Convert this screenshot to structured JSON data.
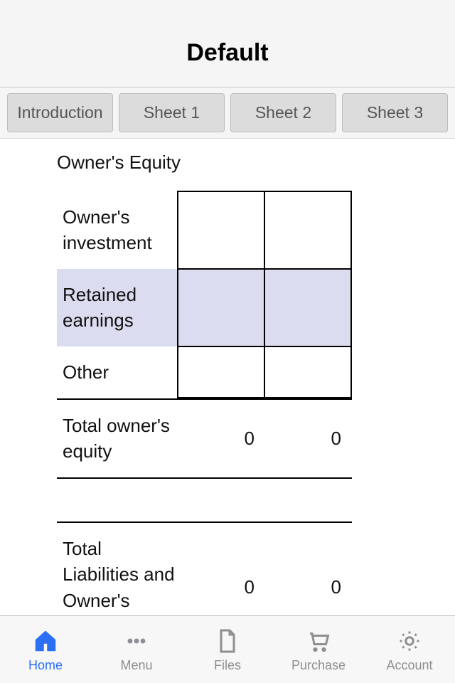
{
  "header": {
    "title": "Default"
  },
  "tabs": [
    "Introduction",
    "Sheet 1",
    "Sheet 2",
    "Sheet 3"
  ],
  "section": {
    "title": "Owner's Equity"
  },
  "rows": [
    {
      "label": "Owner's investment",
      "v1": "",
      "v2": ""
    },
    {
      "label": "Retained earnings",
      "v1": "",
      "v2": ""
    },
    {
      "label": "Other",
      "v1": "",
      "v2": ""
    }
  ],
  "total1": {
    "label": "Total owner's equity",
    "v1": "0",
    "v2": "0"
  },
  "total2": {
    "label": "Total Liabilities and Owner's Equity",
    "v1": "0",
    "v2": "0"
  },
  "tabbar": {
    "home": "Home",
    "menu": "Menu",
    "files": "Files",
    "purchase": "Purchase",
    "account": "Account"
  }
}
